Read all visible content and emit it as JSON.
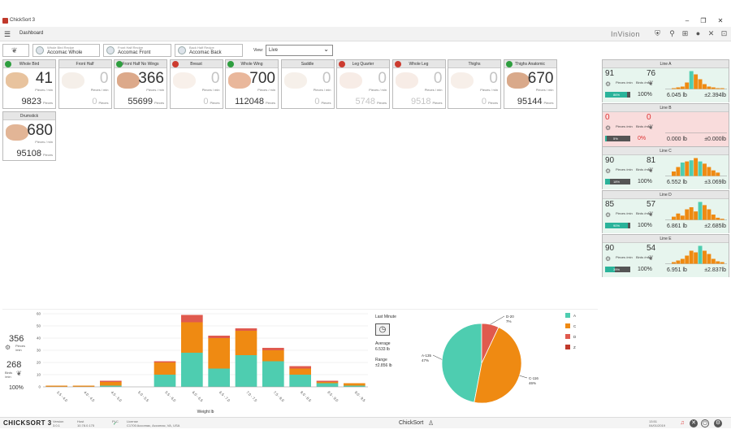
{
  "window": {
    "title": "ChickSort 3",
    "minimize": "–",
    "maximize": "❐",
    "close": "✕"
  },
  "menubar": {
    "page": "Dashboard",
    "brand": "InVision"
  },
  "recipes": [
    {
      "caption": "Whole Bird Recipe",
      "name": "Accomac Whole"
    },
    {
      "caption": "Front Half Recipe",
      "name": "Accomac Front"
    },
    {
      "caption": "Back Half Recipe",
      "name": "Accomac Back"
    }
  ],
  "view": {
    "label": "View:",
    "value": "Live"
  },
  "products": [
    {
      "name": "Whole Bird",
      "rate": "41",
      "total": "9823",
      "status": "green",
      "active": true,
      "color": "#e8c39e"
    },
    {
      "name": "Front Half",
      "rate": "0",
      "total": "0",
      "status": "none",
      "active": false,
      "color": "#e3d2c0"
    },
    {
      "name": "Front Half No Wings",
      "rate": "366",
      "total": "55699",
      "status": "green",
      "active": true,
      "color": "#dca98a"
    },
    {
      "name": "Breast",
      "rate": "0",
      "total": "0",
      "status": "red",
      "active": false,
      "color": "#ead4c4"
    },
    {
      "name": "Whole Wing",
      "rate": "700",
      "total": "112048",
      "status": "green",
      "active": true,
      "color": "#e9b79b"
    },
    {
      "name": "Saddle",
      "rate": "0",
      "total": "0",
      "status": "none",
      "active": false,
      "color": "#e6d4c4"
    },
    {
      "name": "Leg Quarter",
      "rate": "0",
      "total": "5748",
      "status": "red",
      "active": false,
      "color": "#e8c8b6"
    },
    {
      "name": "Whole Leg",
      "rate": "0",
      "total": "9518",
      "status": "red",
      "active": false,
      "color": "#e8c8b6"
    },
    {
      "name": "Thighs",
      "rate": "0",
      "total": "0",
      "status": "none",
      "active": false,
      "color": "#e8d0c0"
    },
    {
      "name": "Thighs Anatomic",
      "rate": "670",
      "total": "95144",
      "status": "green",
      "active": true,
      "color": "#d9a98a"
    },
    {
      "name": "Drumstick",
      "rate": "680",
      "total": "95108",
      "status": "none",
      "active": true,
      "color": "#e2b596"
    }
  ],
  "tile_labels": {
    "per_min": "Pieces / min",
    "pieces": "Pieces"
  },
  "lines": [
    {
      "name": "Line A",
      "pieces": "91",
      "birds": "76",
      "progress": 86,
      "progress_text": "86%",
      "pct": "100%",
      "avg": "6.045 lb",
      "range": "±2.394lb",
      "bg": "#e7f5ee",
      "hist": [
        1,
        2,
        3,
        8,
        22,
        18,
        12,
        6,
        3,
        2,
        1,
        1
      ]
    },
    {
      "name": "Line B",
      "pieces": "0",
      "birds": "0",
      "progress": 5,
      "progress_text": "5%",
      "pct": "0%",
      "avg": "0.000 lb",
      "range": "±0.000lb",
      "bg": "#f9dcdc",
      "hist": []
    },
    {
      "name": "Line C",
      "pieces": "90",
      "birds": "81",
      "progress": 18,
      "progress_text": "18%",
      "pct": "100%",
      "avg": "6.552 lb",
      "range": "±3.069lb",
      "bg": "#e7f5ee",
      "hist": [
        4,
        8,
        12,
        13,
        14,
        16,
        13,
        11,
        8,
        5,
        3
      ]
    },
    {
      "name": "Line D",
      "pieces": "85",
      "birds": "57",
      "progress": 90,
      "progress_text": "90%",
      "pct": "100%",
      "avg": "6.861 lb",
      "range": "±2.685lb",
      "bg": "#e7f5ee",
      "hist": [
        3,
        6,
        4,
        10,
        12,
        8,
        17,
        14,
        10,
        5,
        2,
        1
      ]
    },
    {
      "name": "Line E",
      "pieces": "90",
      "birds": "54",
      "progress": 39,
      "progress_text": "39%",
      "pct": "100%",
      "avg": "6.951 lb",
      "range": "±2.837lb",
      "bg": "#e7f5ee",
      "hist": [
        2,
        4,
        6,
        10,
        16,
        14,
        22,
        16,
        12,
        6,
        3,
        2
      ]
    }
  ],
  "line_labels": {
    "pieces_per_min": "Pieces /min",
    "birds_per_min": "Birds /min"
  },
  "summary": {
    "pieces": "356",
    "pieces_label": "Pieces /min",
    "birds": "268",
    "birds_label": "Birds /min",
    "pct": "100%"
  },
  "stats": {
    "period": "Last Minute",
    "avg_label": "Average",
    "avg": "6.533 lb",
    "range_label": "Range",
    "range": "±2.856 lb"
  },
  "chart_data": [
    {
      "type": "bar",
      "xlabel": "Weight lb",
      "ylabel": "",
      "ylim": [
        0,
        60
      ],
      "yticks": [
        0,
        10,
        20,
        30,
        40,
        50,
        60
      ],
      "categories": [
        "3.5 - 4.0",
        "4.0 - 4.5",
        "4.5 - 5.0",
        "5.0 - 5.5",
        "5.5 - 6.0",
        "6.0 - 6.5",
        "6.5 - 7.0",
        "7.0 - 7.5",
        "7.5 - 8.0",
        "8.0 - 8.5",
        "8.5 - 9.0",
        "9.0 - 9.5"
      ],
      "series": [
        {
          "name": "A",
          "color": "#4ecdb0",
          "values": [
            0,
            0,
            1,
            0,
            10,
            28,
            15,
            26,
            21,
            10,
            3,
            1,
            0
          ]
        },
        {
          "name": "C",
          "color": "#ef8a12",
          "values": [
            1,
            1,
            3,
            0,
            10,
            25,
            25,
            20,
            9,
            5,
            1,
            2,
            0
          ]
        },
        {
          "name": "D",
          "color": "#e05a4e",
          "values": [
            0,
            0,
            1,
            0,
            1,
            6,
            2,
            2,
            2,
            2,
            1,
            0,
            0
          ]
        }
      ]
    },
    {
      "type": "pie",
      "slices": [
        {
          "label": "A-135",
          "pct": "47%",
          "value": 47,
          "color": "#4ecdb0"
        },
        {
          "label": "D-20",
          "pct": "7%",
          "value": 7,
          "color": "#e05a4e"
        },
        {
          "label": "C-116",
          "pct": "46%",
          "value": 46,
          "color": "#ef8a12"
        }
      ],
      "legend": [
        {
          "label": "A",
          "color": "#4ecdb0"
        },
        {
          "label": "C",
          "color": "#ef8a12"
        },
        {
          "label": "D",
          "color": "#e05a4e"
        },
        {
          "label": "Z",
          "color": "#c0392b"
        }
      ]
    }
  ],
  "statusbar": {
    "logo": "CHICKSORT 3",
    "version_label": "Version",
    "version": "3.0.1",
    "host_label": "Host",
    "host": "10.78.0.175",
    "plc_label": "PLC",
    "plc": "✓",
    "license_label": "License",
    "license": "C1700 Accomac, Accomac, VA, USA",
    "center": "ChickSort",
    "time": "13:51",
    "date": "04/01/2019"
  }
}
